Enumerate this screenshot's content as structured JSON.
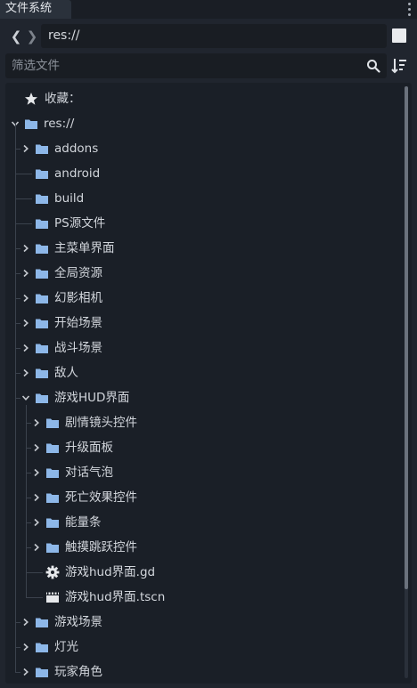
{
  "dock": {
    "tab_title": "文件系统"
  },
  "path": {
    "value": "res://"
  },
  "filter": {
    "placeholder": "筛选文件"
  },
  "tree": {
    "favorites_label": "收藏：",
    "root_label": "res://",
    "items": [
      {
        "label": "addons",
        "level": 1,
        "type": "folder",
        "arrow": "collapsed"
      },
      {
        "label": "android",
        "level": 1,
        "type": "folder",
        "arrow": "none"
      },
      {
        "label": "build",
        "level": 1,
        "type": "folder",
        "arrow": "none"
      },
      {
        "label": "PS源文件",
        "level": 1,
        "type": "folder",
        "arrow": "none"
      },
      {
        "label": "主菜单界面",
        "level": 1,
        "type": "folder",
        "arrow": "collapsed"
      },
      {
        "label": "全局资源",
        "level": 1,
        "type": "folder",
        "arrow": "collapsed"
      },
      {
        "label": "幻影相机",
        "level": 1,
        "type": "folder",
        "arrow": "collapsed"
      },
      {
        "label": "开始场景",
        "level": 1,
        "type": "folder",
        "arrow": "collapsed"
      },
      {
        "label": "战斗场景",
        "level": 1,
        "type": "folder",
        "arrow": "collapsed"
      },
      {
        "label": "敌人",
        "level": 1,
        "type": "folder",
        "arrow": "collapsed"
      },
      {
        "label": "游戏HUD界面",
        "level": 1,
        "type": "folder",
        "arrow": "expanded"
      },
      {
        "label": "剧情镜头控件",
        "level": 2,
        "type": "folder",
        "arrow": "collapsed"
      },
      {
        "label": "升级面板",
        "level": 2,
        "type": "folder",
        "arrow": "collapsed"
      },
      {
        "label": "对话气泡",
        "level": 2,
        "type": "folder",
        "arrow": "collapsed"
      },
      {
        "label": "死亡效果控件",
        "level": 2,
        "type": "folder",
        "arrow": "collapsed"
      },
      {
        "label": "能量条",
        "level": 2,
        "type": "folder",
        "arrow": "collapsed"
      },
      {
        "label": "触摸跳跃控件",
        "level": 2,
        "type": "folder",
        "arrow": "collapsed"
      },
      {
        "label": "游戏hud界面.gd",
        "level": 2,
        "type": "script",
        "arrow": "none"
      },
      {
        "label": "游戏hud界面.tscn",
        "level": 2,
        "type": "scene",
        "arrow": "none"
      },
      {
        "label": "游戏场景",
        "level": 1,
        "type": "folder",
        "arrow": "collapsed"
      },
      {
        "label": "灯光",
        "level": 1,
        "type": "folder",
        "arrow": "collapsed"
      },
      {
        "label": "玩家角色",
        "level": 1,
        "type": "folder",
        "arrow": "collapsed"
      }
    ]
  },
  "icons": {
    "folder": "folder-icon",
    "script": "gear-icon",
    "scene": "clapperboard-icon",
    "favorites": "star-icon"
  },
  "colors": {
    "folder": "#8db7e8",
    "background": "#1d2229",
    "tree_background": "#1a1f27"
  }
}
